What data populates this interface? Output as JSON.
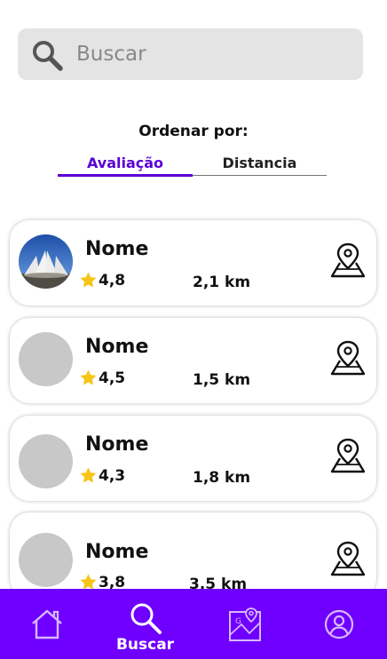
{
  "search": {
    "placeholder": "Buscar",
    "icon": "search-icon"
  },
  "sort": {
    "title": "Ordenar por:",
    "tabs": [
      {
        "label": "Avaliação",
        "active": true
      },
      {
        "label": "Distancia",
        "active": false
      }
    ],
    "accent": "#5a00d6"
  },
  "places": [
    {
      "name": "Nome",
      "rating": "4,8",
      "distance": "2,1 km",
      "has_photo": true
    },
    {
      "name": "Nome",
      "rating": "4,5",
      "distance": "1,5 km",
      "has_photo": false
    },
    {
      "name": "Nome",
      "rating": "4,3",
      "distance": "1,8 km",
      "has_photo": false
    },
    {
      "name": "Nome",
      "rating": "3,8",
      "distance": "3,5 km",
      "has_photo": false
    }
  ],
  "navbar": {
    "color": "#6f00ff",
    "items": [
      {
        "icon": "home-icon",
        "label": ""
      },
      {
        "icon": "search-icon",
        "label": "Buscar",
        "active": true
      },
      {
        "icon": "map-icon",
        "label": ""
      },
      {
        "icon": "profile-icon",
        "label": ""
      }
    ]
  }
}
